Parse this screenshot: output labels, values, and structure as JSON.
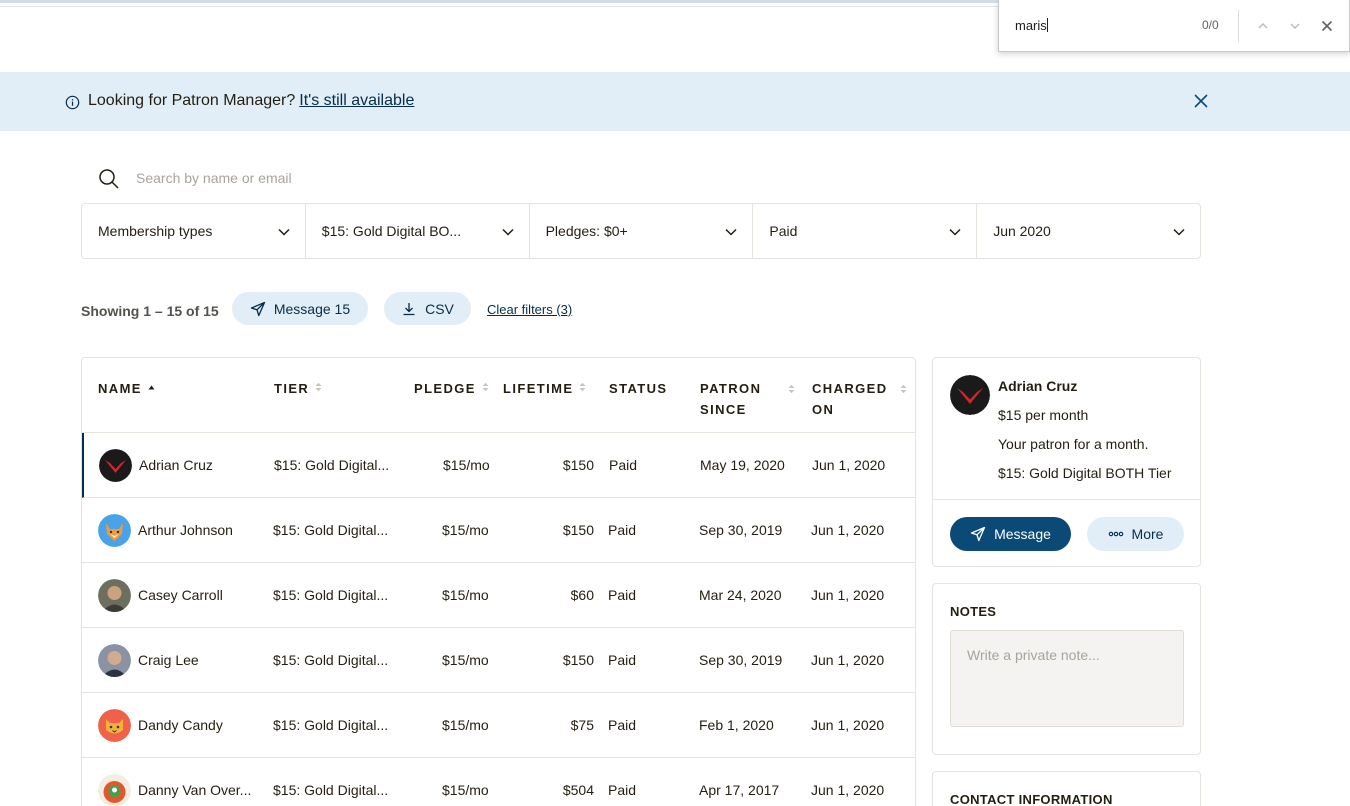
{
  "find_bar": {
    "query": "maris",
    "count": "0/0"
  },
  "banner": {
    "text": "Looking for Patron Manager?",
    "link": "It's still available"
  },
  "search": {
    "placeholder": "Search by name or email"
  },
  "filters": [
    {
      "label": "Membership types"
    },
    {
      "label": "$15: Gold Digital BO..."
    },
    {
      "label": "Pledges: $0+"
    },
    {
      "label": "Paid"
    },
    {
      "label": "Jun 2020"
    }
  ],
  "actions": {
    "showing": "Showing 1 – 15 of 15",
    "message_label": "Message 15",
    "csv_label": "CSV",
    "clear_filters": "Clear filters (3)"
  },
  "table": {
    "columns": {
      "name": "NAME",
      "tier": "TIER",
      "pledge": "PLEDGE",
      "lifetime": "LIFETIME",
      "status": "STATUS",
      "patron_since_1": "PATRON",
      "patron_since_2": "SINCE",
      "charged_on_1": "CHARGED",
      "charged_on_2": "ON"
    },
    "rows": [
      {
        "name": "Adrian Cruz",
        "tier": "$15: Gold Digital...",
        "pledge": "$15/mo",
        "lifetime": "$150",
        "status": "Paid",
        "patron_since": "May 19, 2020",
        "charged_on": "Jun 1, 2020",
        "avatar": "red-logo"
      },
      {
        "name": "Arthur Johnson",
        "tier": "$15: Gold Digital...",
        "pledge": "$15/mo",
        "lifetime": "$150",
        "status": "Paid",
        "patron_since": "Sep 30, 2019",
        "charged_on": "Jun 1, 2020",
        "avatar": "fox"
      },
      {
        "name": "Casey Carroll",
        "tier": "$15: Gold Digital...",
        "pledge": "$15/mo",
        "lifetime": "$60",
        "status": "Paid",
        "patron_since": "Mar 24, 2020",
        "charged_on": "Jun 1, 2020",
        "avatar": "photo"
      },
      {
        "name": "Craig Lee",
        "tier": "$15: Gold Digital...",
        "pledge": "$15/mo",
        "lifetime": "$150",
        "status": "Paid",
        "patron_since": "Sep 30, 2019",
        "charged_on": "Jun 1, 2020",
        "avatar": "photo"
      },
      {
        "name": "Dandy Candy",
        "tier": "$15: Gold Digital...",
        "pledge": "$15/mo",
        "lifetime": "$75",
        "status": "Paid",
        "patron_since": "Feb 1, 2020",
        "charged_on": "Jun 1, 2020",
        "avatar": "cat"
      },
      {
        "name": "Danny Van Over...",
        "tier": "$15: Gold Digital...",
        "pledge": "$15/mo",
        "lifetime": "$504",
        "status": "Paid",
        "patron_since": "Apr 17, 2017",
        "charged_on": "Jun 1, 2020",
        "avatar": "cartoon"
      }
    ]
  },
  "patron_card": {
    "name": "Adrian Cruz",
    "amount": "$15 per month",
    "duration": "Your patron for a month.",
    "tier": "$15: Gold Digital BOTH Tier",
    "message_label": "Message",
    "more_label": "More"
  },
  "notes": {
    "title": "NOTES",
    "placeholder": "Write a private note..."
  },
  "contact": {
    "title": "CONTACT INFORMATION"
  },
  "colors": {
    "accent": "#052d49",
    "banner_bg": "#e1eef8",
    "primary_button": "#0b4a77"
  }
}
